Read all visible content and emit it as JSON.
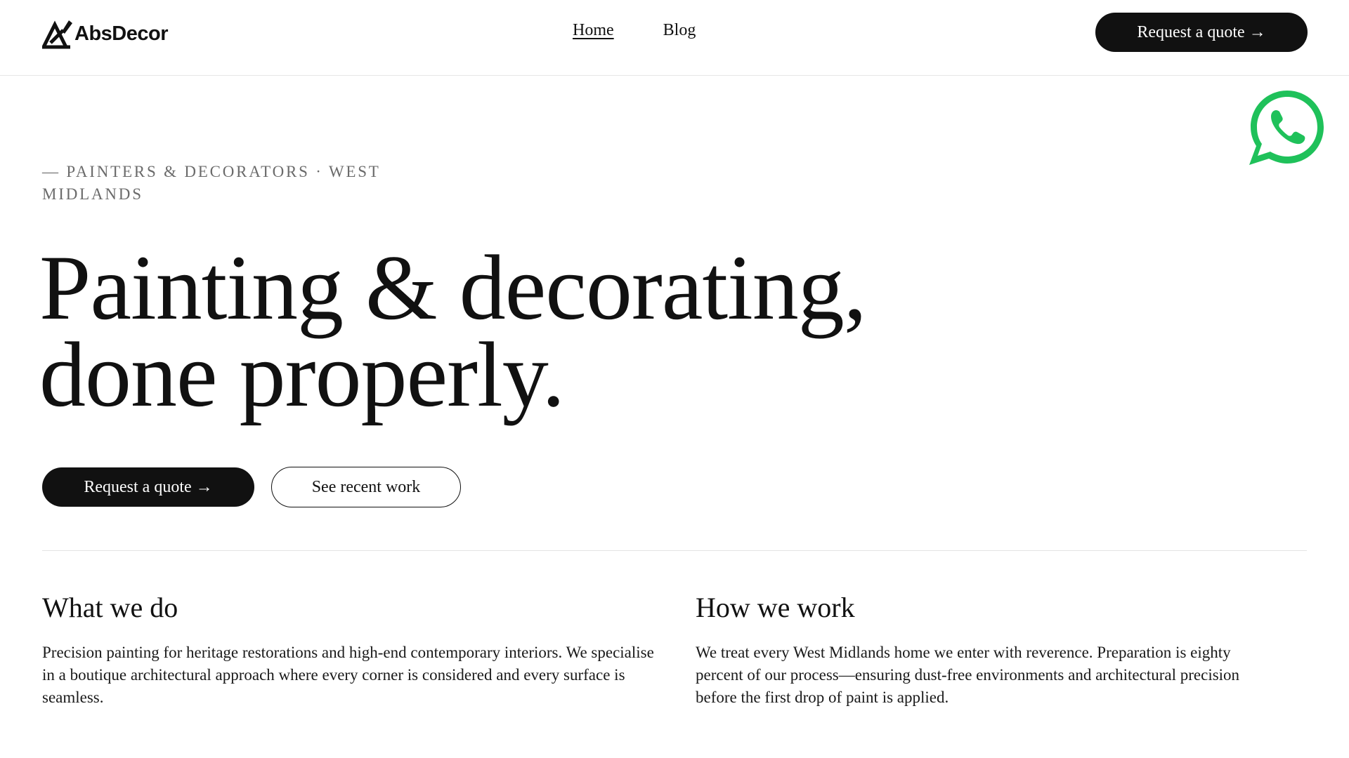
{
  "brand": {
    "name": "AbsDecor",
    "accent": "#111111",
    "whatsapp_color": "#1FC15A"
  },
  "nav": {
    "items": [
      {
        "label": "Home",
        "active": true
      },
      {
        "label": "Blog",
        "active": false
      }
    ],
    "cta_label": "Request a quote →"
  },
  "floating": {
    "whatsapp_icon": "whatsapp-icon"
  },
  "hero": {
    "eyebrow": "— PAINTERS & DECORATORS · WEST MIDLANDS",
    "title_line1": "Painting & decorating,",
    "title_line2": "done properly.",
    "primary_cta": "Request a quote →",
    "secondary_cta": "See recent work"
  },
  "sections": [
    {
      "heading": "What we do",
      "body": "Precision painting for heritage restorations and high-end contemporary interiors. We specialise in a boutique architectural approach where every corner is considered and every surface is seamless."
    },
    {
      "heading": "How we work",
      "body": "We treat every West Midlands home we enter with reverence. Preparation is eighty percent of our process—ensuring dust-free environments and architectural precision before the first drop of paint is applied."
    }
  ]
}
